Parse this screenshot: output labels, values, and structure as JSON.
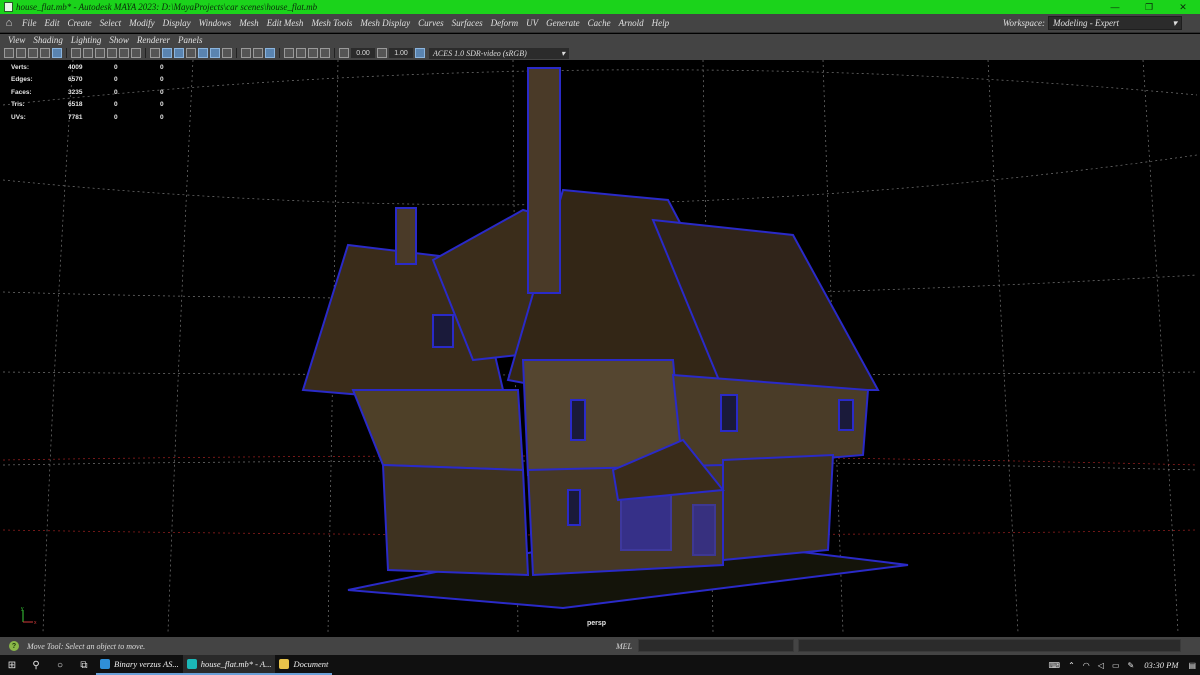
{
  "window": {
    "title": "house_flat.mb* - Autodesk MAYA 2023: D:\\MayaProjects\\car scenes\\house_flat.mb",
    "minimize": "—",
    "maximize": "❐",
    "close": "✕"
  },
  "menubar": {
    "items": [
      "File",
      "Edit",
      "Create",
      "Select",
      "Modify",
      "Display",
      "Windows",
      "Mesh",
      "Edit Mesh",
      "Mesh Tools",
      "Mesh Display",
      "Curves",
      "Surfaces",
      "Deform",
      "UV",
      "Generate",
      "Cache",
      "Arnold",
      "Help"
    ],
    "workspace_label": "Workspace:",
    "workspace_value": "Modeling - Expert"
  },
  "panel_menu": {
    "items": [
      "View",
      "Shading",
      "Lighting",
      "Show",
      "Renderer",
      "Panels"
    ]
  },
  "toolbar": {
    "field_a": "0.00",
    "field_b": "1.00",
    "color_space": "ACES 1.0 SDR-video (sRGB)"
  },
  "hud": {
    "rows": [
      {
        "label": "Verts:",
        "v1": "4009",
        "v2": "0",
        "v3": "0"
      },
      {
        "label": "Edges:",
        "v1": "6570",
        "v2": "0",
        "v3": "0"
      },
      {
        "label": "Faces:",
        "v1": "3235",
        "v2": "0",
        "v3": "0"
      },
      {
        "label": "Tris:",
        "v1": "6518",
        "v2": "0",
        "v3": "0"
      },
      {
        "label": "UVs:",
        "v1": "7781",
        "v2": "0",
        "v3": "0"
      }
    ]
  },
  "viewport": {
    "camera_label": "persp",
    "axis_x": "x",
    "axis_y": "y"
  },
  "helpline": {
    "text": "Move Tool: Select an object to move.",
    "mel_label": "MEL"
  },
  "taskbar": {
    "tasks": [
      {
        "label": "Binary verzus AS..."
      },
      {
        "label": "house_flat.mb* - A..."
      },
      {
        "label": "Document"
      }
    ],
    "clock": "03:30 PM"
  },
  "colors": {
    "title_bar": "#1bd31b",
    "ui_panel": "#444444",
    "viewport_bg": "#000000",
    "wire": "#2a2ac8",
    "grid": "#d8d8d8",
    "grid_red": "#c82a2a"
  }
}
